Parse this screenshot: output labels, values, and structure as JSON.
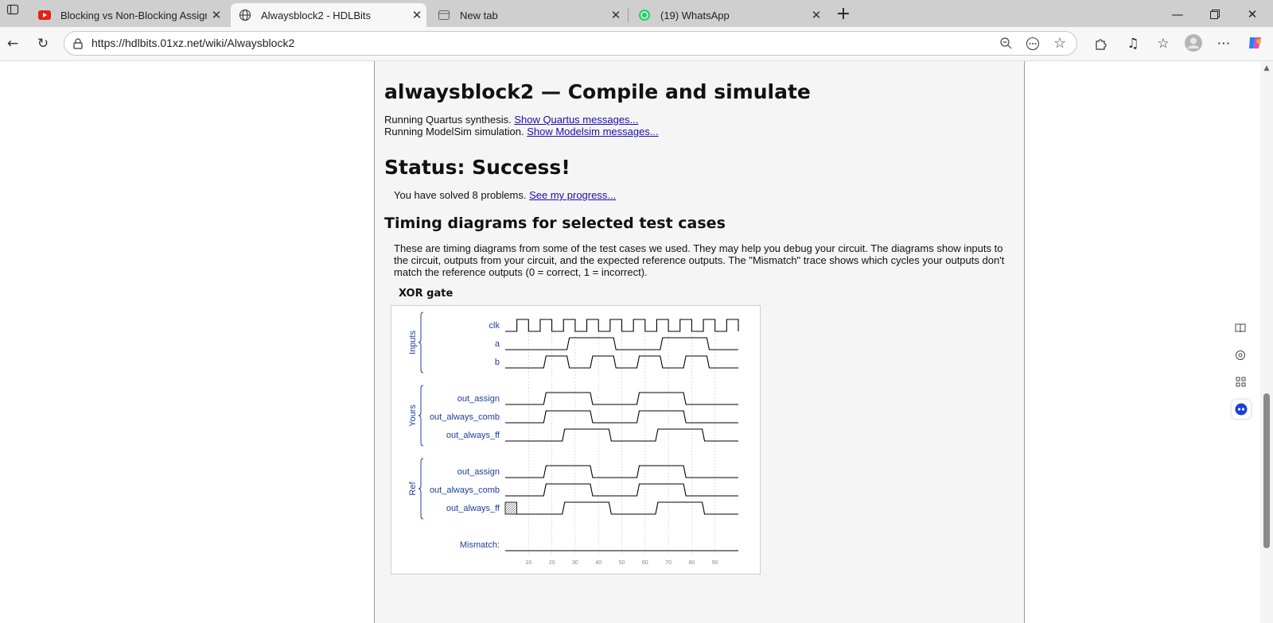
{
  "browser": {
    "tabs": [
      {
        "title": "Blocking vs Non-Blocking Assignm",
        "favicon": "youtube-icon",
        "active": false
      },
      {
        "title": "Alwaysblock2 - HDLBits",
        "favicon": "globe-icon",
        "active": true
      },
      {
        "title": "New tab",
        "favicon": "newtab-icon",
        "active": false
      },
      {
        "title": "(19) WhatsApp",
        "favicon": "whatsapp-icon",
        "active": false
      }
    ],
    "url": "https://hdlbits.01xz.net/wiki/Alwaysblock2"
  },
  "page": {
    "title": "alwaysblock2 — Compile and simulate",
    "run1_text": "Running Quartus synthesis. ",
    "run1_link": "Show Quartus messages...",
    "run2_text": "Running ModelSim simulation. ",
    "run2_link": "Show Modelsim messages...",
    "status": "Status: Success!",
    "solved_text": "You have solved 8 problems. ",
    "solved_link": "See my progress...",
    "timing_heading": "Timing diagrams for selected test cases",
    "description": "These are timing diagrams from some of the test cases we used. They may help you debug your circuit. The diagrams show inputs to the circuit, outputs from your circuit, and the expected reference outputs. The \"Mismatch\" trace shows which cycles your outputs don't match the reference outputs (0 = correct, 1 = incorrect).",
    "diagram_title": "XOR gate"
  },
  "waveform": {
    "groups": [
      {
        "label": "Inputs",
        "signals": [
          "clk",
          "a",
          "b"
        ]
      },
      {
        "label": "Yours",
        "signals": [
          "out_assign",
          "out_always_comb",
          "out_always_ff"
        ]
      },
      {
        "label": "Ref",
        "signals": [
          "out_assign",
          "out_always_comb",
          "out_always_ff"
        ]
      }
    ],
    "mismatch_label": "Mismatch:",
    "time_ticks": [
      "10",
      "20",
      "30",
      "40",
      "50",
      "60",
      "70",
      "80",
      "90"
    ],
    "t_max": 100,
    "clock": {
      "first_rise": 5,
      "period": 10,
      "high": 5
    },
    "traces": {
      "a": {
        "initial": 0,
        "transitions": [
          27,
          47,
          67,
          87
        ]
      },
      "b": {
        "initial": 0,
        "transitions": [
          17,
          27,
          37,
          47,
          57,
          67,
          77,
          87
        ]
      },
      "yours_out_assign": {
        "initial": 0,
        "transitions": [
          17,
          37,
          57,
          77
        ]
      },
      "yours_out_always_comb": {
        "initial": 0,
        "transitions": [
          17,
          37,
          57,
          77
        ]
      },
      "yours_out_always_ff": {
        "initial": 0,
        "transitions": [
          25,
          45,
          65,
          85
        ]
      },
      "ref_out_assign": {
        "initial": 0,
        "transitions": [
          17,
          37,
          57,
          77
        ]
      },
      "ref_out_always_comb": {
        "initial": 0,
        "transitions": [
          17,
          37,
          57,
          77
        ]
      },
      "ref_out_always_ff": {
        "initial": 0,
        "transitions": [
          25,
          45,
          65,
          85
        ],
        "unknown_until": 5
      },
      "mismatch": {
        "initial": 0,
        "transitions": []
      }
    },
    "colors": {
      "label": "#1c3f9c",
      "trace": "#000000",
      "grid": "#c8c8c8",
      "tick": "#888888"
    }
  }
}
